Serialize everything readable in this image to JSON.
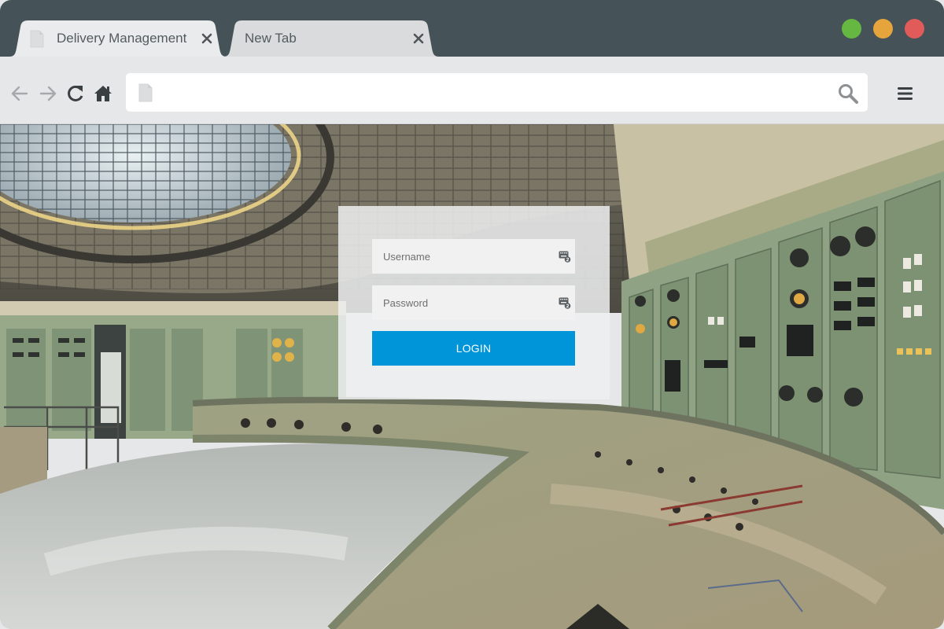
{
  "browser": {
    "tabs": [
      {
        "title": "Delivery Management",
        "active": true,
        "icon": "page-icon",
        "close_icon": "close-icon"
      },
      {
        "title": "New Tab",
        "active": false,
        "icon": "",
        "close_icon": "close-icon"
      }
    ],
    "window_controls": [
      "maximize",
      "minimize",
      "close"
    ],
    "toolbar": {
      "nav_icons": [
        "back-arrow-icon",
        "forward-arrow-icon",
        "reload-icon",
        "home-icon"
      ],
      "address_value": "",
      "address_icon": "page-icon",
      "search_icon": "search-icon",
      "menu_icon": "hamburger-menu-icon"
    }
  },
  "login": {
    "username_placeholder": "Username",
    "password_placeholder": "Password",
    "field_icon": "keyboard-icon",
    "button_label": "LOGIN"
  },
  "colors": {
    "titlebar": "#455358",
    "toolbar": "#e6e7e8",
    "accent_button": "#0095d9",
    "light_green": "#65b741",
    "light_yellow": "#e5a43c",
    "light_red": "#e15b5b"
  },
  "background": "control-room-photo"
}
